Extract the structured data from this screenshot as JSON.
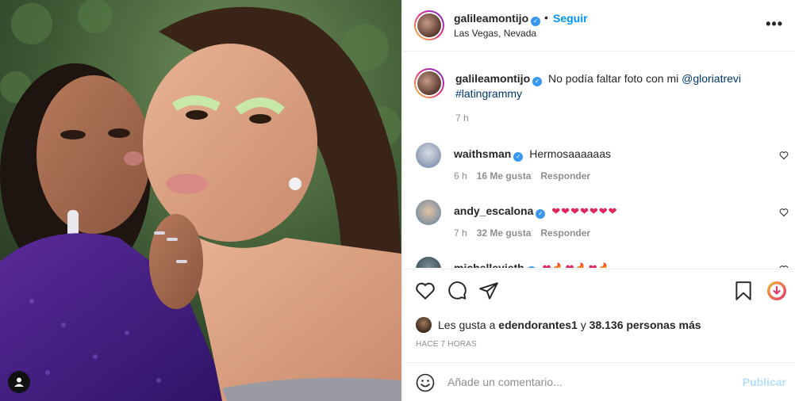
{
  "post": {
    "username": "galileamontijo",
    "follow_label": "Seguir",
    "location": "Las Vegas, Nevada",
    "dot": "•",
    "more_label": "•••"
  },
  "caption": {
    "username": "galileamontijo",
    "text": "No podía faltar foto con mi",
    "mention": "@gloriatrevi",
    "hashtag": "#latingrammy",
    "time": "7 h"
  },
  "comments": [
    {
      "username": "waithsman",
      "text": "Hermosaaaaaas",
      "time": "6 h",
      "likes": "16 Me gusta",
      "reply": "Responder"
    },
    {
      "username": "andy_escalona",
      "text": "❤❤❤❤❤❤❤",
      "time": "7 h",
      "likes": "32 Me gusta",
      "reply": "Responder"
    },
    {
      "username": "michellevieth",
      "text": "❤🔥❤🔥❤🔥"
    }
  ],
  "likes_line": {
    "prefix": "Les gusta a",
    "user": "edendorantes1",
    "middle": "y",
    "count": "38.136 personas más"
  },
  "time_ago": "HACE 7 HORAS",
  "add_comment": {
    "placeholder": "Añade un comentario...",
    "publish_label": "Publicar"
  },
  "colors": {
    "accent": "#0095f6",
    "verified": "#3897f0",
    "heart": "#e0245e",
    "publish_disabled": "#b2dffc"
  },
  "icons": [
    "heart-icon",
    "comment-icon",
    "share-icon",
    "bookmark-icon",
    "download-icon",
    "emoji-icon",
    "more-icon",
    "verified-icon",
    "user-tag-icon"
  ]
}
